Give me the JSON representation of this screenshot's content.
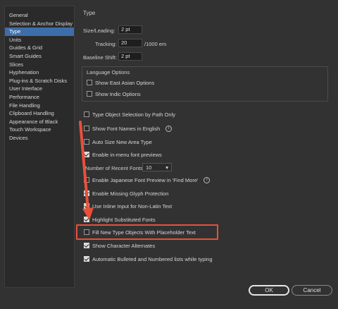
{
  "sidebar": {
    "items": [
      {
        "label": "General",
        "selected": false
      },
      {
        "label": "Selection & Anchor Display",
        "selected": false
      },
      {
        "label": "Type",
        "selected": true
      },
      {
        "label": "Units",
        "selected": false
      },
      {
        "label": "Guides & Grid",
        "selected": false
      },
      {
        "label": "Smart Guides",
        "selected": false
      },
      {
        "label": "Slices",
        "selected": false
      },
      {
        "label": "Hyphenation",
        "selected": false
      },
      {
        "label": "Plug-ins & Scratch Disks",
        "selected": false
      },
      {
        "label": "User Interface",
        "selected": false
      },
      {
        "label": "Performance",
        "selected": false
      },
      {
        "label": "File Handling",
        "selected": false
      },
      {
        "label": "Clipboard Handling",
        "selected": false
      },
      {
        "label": "Appearance of Black",
        "selected": false
      },
      {
        "label": "Touch Workspace",
        "selected": false
      },
      {
        "label": "Devices",
        "selected": false
      }
    ]
  },
  "panel": {
    "title": "Type",
    "size_leading_label": "Size/Leading:",
    "size_leading_value": "2 pt",
    "tracking_label": "Tracking:",
    "tracking_value": "20",
    "tracking_unit": "/1000 em",
    "baseline_shift_label": "Baseline Shift:",
    "baseline_shift_value": "2 pt",
    "language_options_title": "Language Options",
    "show_east_asian": {
      "label": "Show East Asian Options",
      "checked": false
    },
    "show_indic": {
      "label": "Show Indic Options",
      "checked": false
    },
    "options": [
      {
        "label": "Type Object Selection by Path Only",
        "checked": false,
        "info": false
      },
      {
        "label": "Show Font Names in English",
        "checked": false,
        "info": true
      },
      {
        "label": "Auto Size New Area Type",
        "checked": false,
        "info": false
      },
      {
        "label": "Enable in-menu font previews",
        "checked": true,
        "info": false
      }
    ],
    "recent_fonts_label": "Number of Recent Fonts:",
    "recent_fonts_value": "10",
    "options2": [
      {
        "label": "Enable Japanese Font Preview in 'Find More'",
        "checked": false,
        "info": true
      },
      {
        "label": "Enable Missing Glyph Protection",
        "checked": true,
        "info": false
      },
      {
        "label": "Use Inline Input for Non-Latin Text",
        "checked": true,
        "info": false
      },
      {
        "label": "Highlight Substituted Fonts",
        "checked": true,
        "info": false
      },
      {
        "label": "Fill New Type Objects With Placeholder Text",
        "checked": false,
        "info": false
      },
      {
        "label": "Show Character Alternates",
        "checked": true,
        "info": false
      },
      {
        "label": "Automatic Bulleted and Numbered lists while typing",
        "checked": true,
        "info": false
      }
    ]
  },
  "buttons": {
    "ok": "OK",
    "cancel": "Cancel"
  },
  "colors": {
    "background": "#323232",
    "selection": "#3d6ea9",
    "highlight": "#e8503a"
  },
  "icons": {
    "info": "info-icon",
    "arrow": "annotation-arrow-icon",
    "dropdown": "chevron-down-icon"
  }
}
